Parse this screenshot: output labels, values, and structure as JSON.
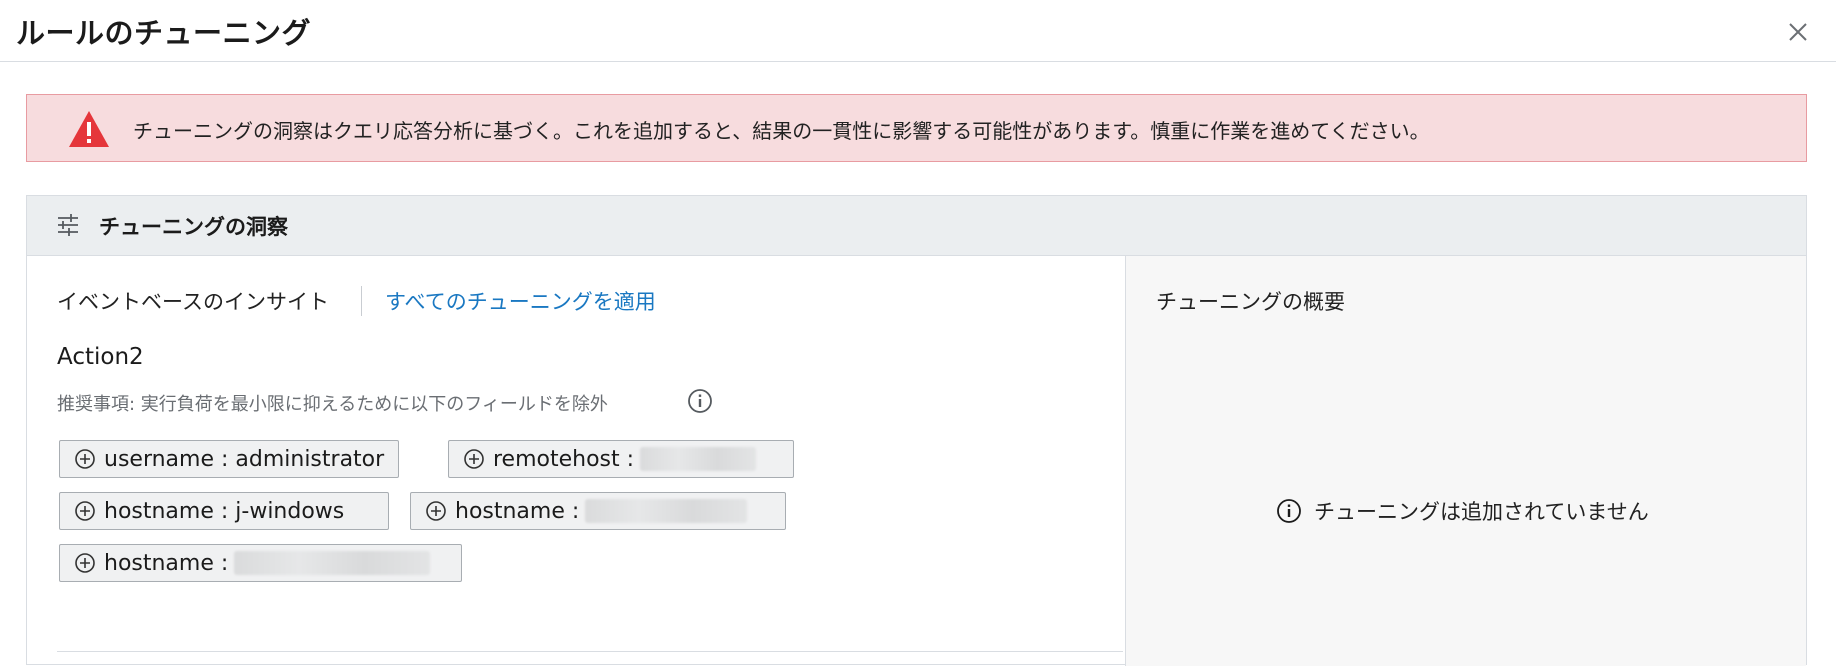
{
  "dialog": {
    "title": "ルールのチューニング",
    "close_icon": "close-icon"
  },
  "alert": {
    "icon": "warning-triangle-icon",
    "color": "#e5363b",
    "background": "#f7dcde",
    "message": "チューニングの洞察はクエリ応答分析に基づく。これを追加すると、結果の一貫性に影響する可能性があります。慎重に作業を進めてください。"
  },
  "panel": {
    "header_icon": "sliders-icon",
    "title": "チューニングの洞察",
    "insights": {
      "tab_label": "イベントベースのインサイト",
      "apply_all_label": "すべてのチューニングを適用",
      "link_color": "#1a78c2",
      "action": {
        "name": "Action2",
        "recommendation": "推奨事項: 実行負荷を最小限に抑えるために以下のフィールドを除外",
        "info_icon": "info-icon",
        "chips": [
          {
            "text": "username : administrator",
            "icon": "plus-circle-icon"
          },
          {
            "text": "remotehost : ",
            "icon": "plus-circle-icon",
            "redacted": true
          },
          {
            "text": "hostname : j-windows",
            "icon": "plus-circle-icon"
          },
          {
            "text": "hostname : ",
            "icon": "plus-circle-icon",
            "redacted": true
          },
          {
            "text": "hostname : ",
            "icon": "plus-circle-icon",
            "redacted": true
          }
        ]
      }
    },
    "summary": {
      "title": "チューニングの概要",
      "empty_icon": "info-icon",
      "empty_text": "チューニングは追加されていません"
    }
  }
}
